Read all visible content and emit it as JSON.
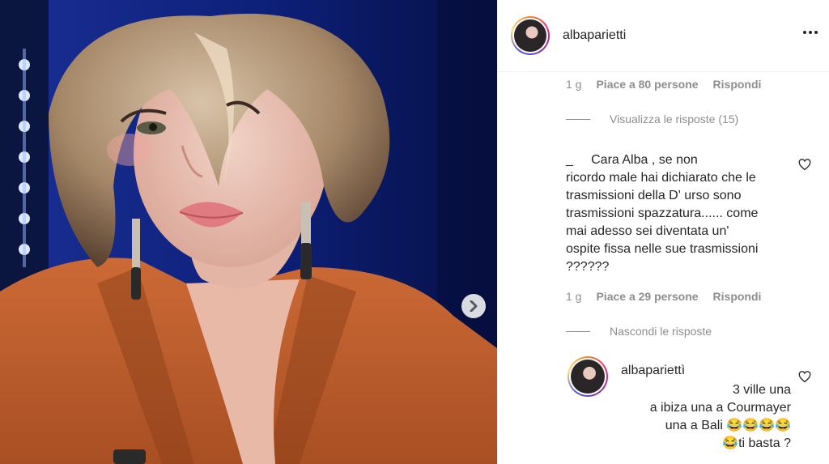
{
  "header": {
    "username": "albaparietti"
  },
  "comments": [
    {
      "time": "1 g",
      "likes": "Piace a 80 persone",
      "reply": "Rispondi"
    },
    {
      "toggle": "Visualizza le risposte (15)"
    },
    {
      "text": "_     Cara Alba , se non\nricordo male hai dichiarato che le\ntrasmissioni della D' urso sono\ntrasmissioni spazzatura...... come\nmai adesso sei diventata un'\nospite fissa nelle sue trasmissioni\n??????",
      "time": "1 g",
      "likes": "Piace a 29 persone",
      "reply": "Rispondi"
    },
    {
      "toggle": "Nascondi le risposte"
    }
  ],
  "reply": {
    "username": "albapariettì",
    "text": "3 ville una\na ibiza una a Courmayer\nuna a Bali 😂😂😂😂\n😂ti basta ?"
  },
  "icons": {
    "next": "chevron-right-icon",
    "more": "more-horizontal-icon",
    "like": "heart-icon"
  },
  "colors": {
    "muted": "#8e8e8e",
    "text": "#262626",
    "border": "#efefef",
    "jacket": "#c0622f",
    "background": "#0b1a63"
  }
}
